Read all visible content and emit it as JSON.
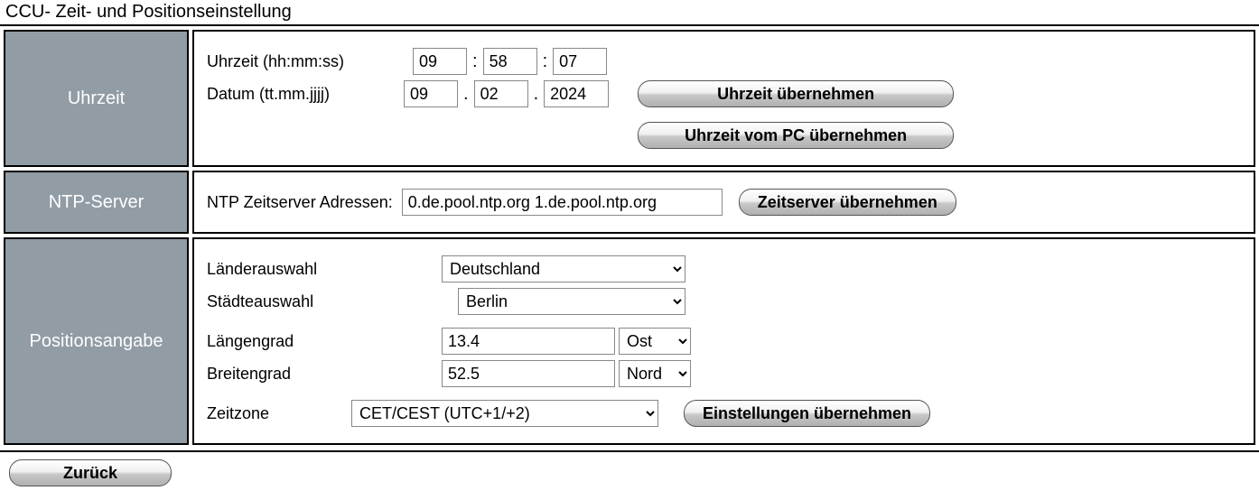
{
  "title": "CCU- Zeit- und Positionseinstellung",
  "sections": {
    "time": {
      "header": "Uhrzeit",
      "time_label": "Uhrzeit (hh:mm:ss)",
      "hh": "09",
      "mm": "58",
      "ss": "07",
      "colon": ":",
      "date_label": "Datum (tt.mm.jjjj)",
      "dd": "09",
      "mo": "02",
      "yyyy": "2024",
      "dot": ".",
      "btn_apply": "Uhrzeit übernehmen",
      "btn_from_pc": "Uhrzeit vom PC übernehmen"
    },
    "ntp": {
      "header": "NTP-Server",
      "label": "NTP Zeitserver Adressen:",
      "value": "0.de.pool.ntp.org 1.de.pool.ntp.org",
      "btn": "Zeitserver übernehmen"
    },
    "pos": {
      "header": "Positionsangabe",
      "country_label": "Länderauswahl",
      "country": "Deutschland",
      "city_label": "Städteauswahl",
      "city": "Berlin",
      "lon_label": "Längengrad",
      "lon": "13.4",
      "lon_dir": "Ost",
      "lat_label": "Breitengrad",
      "lat": "52.5",
      "lat_dir": "Nord",
      "tz_label": "Zeitzone",
      "tz": "CET/CEST (UTC+1/+2)",
      "btn": "Einstellungen übernehmen"
    }
  },
  "footer": {
    "back": "Zurück"
  }
}
